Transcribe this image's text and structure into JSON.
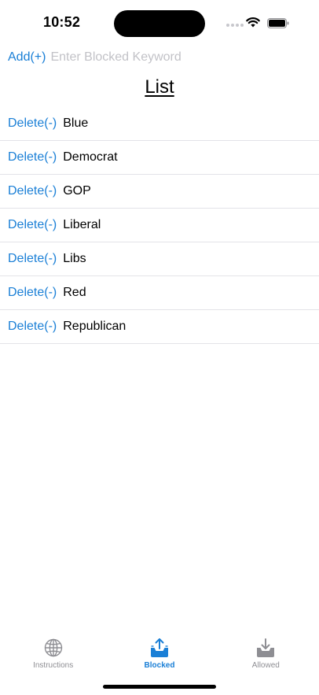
{
  "status_bar": {
    "time": "10:52"
  },
  "add_row": {
    "add_label": "Add(+)",
    "input_placeholder": "Enter Blocked Keyword",
    "input_value": ""
  },
  "list": {
    "title": "List",
    "delete_label": "Delete(-)",
    "items": [
      "Blue",
      "Democrat",
      "GOP",
      "Liberal",
      "Libs",
      "Red",
      "Republican"
    ]
  },
  "tab_bar": {
    "tabs": [
      {
        "label": "Instructions",
        "icon": "globe-icon",
        "active": false
      },
      {
        "label": "Blocked",
        "icon": "tray-upload-icon",
        "active": true
      },
      {
        "label": "Allowed",
        "icon": "tray-download-icon",
        "active": false
      }
    ]
  },
  "colors": {
    "accent": "#1a7fd6",
    "inactive_tab": "#8e8e93",
    "separator": "#e3e3e8",
    "placeholder": "#c2c2c7"
  }
}
